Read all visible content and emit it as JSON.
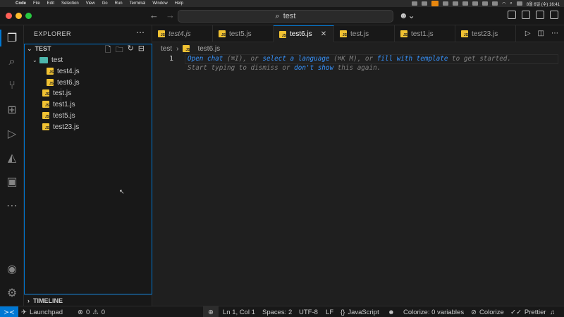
{
  "menubar": {
    "app_name": "Code",
    "items": [
      "File",
      "Edit",
      "Selection",
      "View",
      "Go",
      "Run",
      "Terminal",
      "Window",
      "Help"
    ],
    "clock": "8월 6일 (수) 16:41"
  },
  "titlebar": {
    "search_text": "test"
  },
  "sidebar": {
    "title": "EXPLORER",
    "root_folder": "TEST",
    "tree": [
      {
        "label": "test",
        "type": "folder"
      },
      {
        "label": "test4.js",
        "type": "file"
      },
      {
        "label": "test6.js",
        "type": "file"
      },
      {
        "label": "test.js",
        "type": "file"
      },
      {
        "label": "test1.js",
        "type": "file"
      },
      {
        "label": "test5.js",
        "type": "file"
      },
      {
        "label": "test23.js",
        "type": "file"
      }
    ],
    "timeline_label": "TIMELINE"
  },
  "tabs": [
    {
      "label": "test4.js",
      "italic": true
    },
    {
      "label": "test5.js",
      "italic": false
    },
    {
      "label": "test6.js",
      "italic": false,
      "active": true
    },
    {
      "label": "test.js",
      "italic": false
    },
    {
      "label": "test1.js",
      "italic": false
    },
    {
      "label": "test23.js",
      "italic": false
    }
  ],
  "breadcrumb": {
    "folder": "test",
    "file": "test6.js"
  },
  "editor": {
    "line_number": "1",
    "hint_line1": {
      "link1": "Open chat",
      "text1": " (⌘I), or ",
      "link2": "select a language",
      "text2": " (⌘K M), or ",
      "link3": "fill with template",
      "text3": " to get started."
    },
    "hint_line2": {
      "text1": "Start typing to dismiss or ",
      "link1": "don't show",
      "text2": " this again."
    }
  },
  "statusbar": {
    "launchpad": "Launchpad",
    "errors": "0",
    "warnings": "0",
    "position": "Ln 1, Col 1",
    "spaces": "Spaces: 2",
    "encoding": "UTF-8",
    "eol": "LF",
    "language": "JavaScript",
    "colorize_vars": "Colorize: 0 variables",
    "colorize": "Colorize",
    "prettier": "Prettier"
  },
  "colors": {
    "accent": "#0078d4",
    "js_icon": "#f1c232",
    "folder_icon": "#4db6ac",
    "link": "#3794ff"
  }
}
